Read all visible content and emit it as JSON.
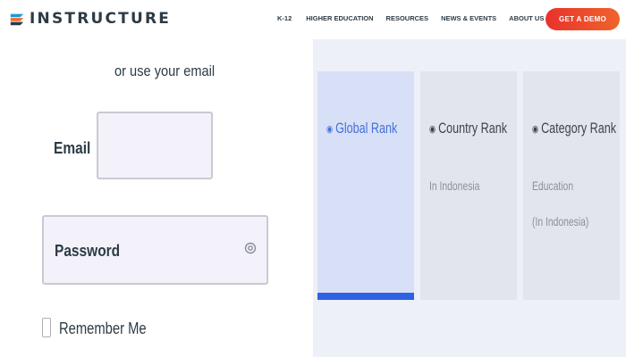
{
  "header": {
    "brand": "INSTRUCTURE",
    "nav": [
      {
        "label": "K-12"
      },
      {
        "label": "HIGHER EDUCATION"
      },
      {
        "label": "RESOURCES"
      },
      {
        "label": "NEWS & EVENTS"
      },
      {
        "label": "ABOUT US"
      }
    ],
    "cta_label": "GET A DEMO"
  },
  "login": {
    "alt_prompt": "or use your email",
    "email_label": "Email",
    "email_value": "",
    "password_label": "Password",
    "password_value": "",
    "remember_label": "Remember Me",
    "remember_checked": false
  },
  "ranks": {
    "cards": [
      {
        "title": "Global Rank",
        "subtitle": "",
        "subtitle2": "",
        "active": true,
        "icon": "globe-icon"
      },
      {
        "title": "Country Rank",
        "subtitle": "In Indonesia",
        "subtitle2": "",
        "active": false,
        "icon": "pin-icon"
      },
      {
        "title": "Category Rank",
        "subtitle": "Education",
        "subtitle2": "(In Indonesia)",
        "active": false,
        "icon": "category-icon"
      }
    ]
  },
  "colors": {
    "cta_gradient_start": "#e8322d",
    "cta_gradient_end": "#f0642c",
    "active_bar": "#2d62e2",
    "active_title": "#4771d8"
  }
}
